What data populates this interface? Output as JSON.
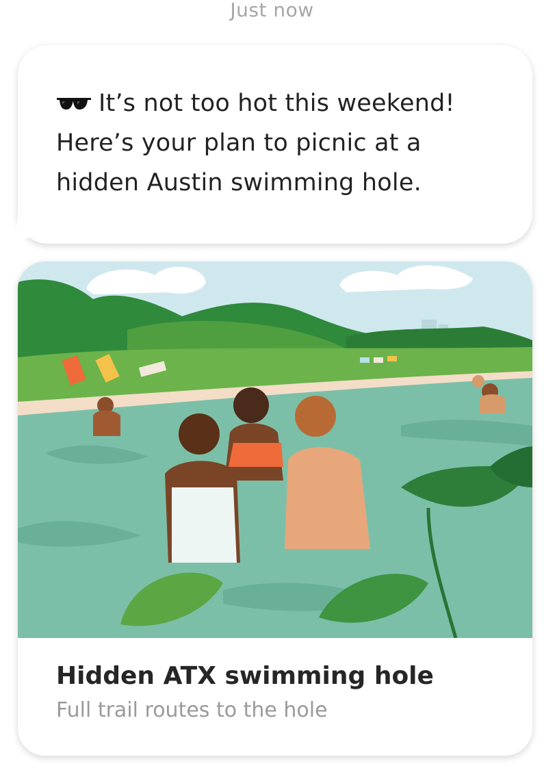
{
  "message": {
    "timestamp": "Just now",
    "emoji_icon": "sunglasses-icon",
    "lines": [
      "It’s not too hot this weekend!",
      "Here’s your plan to picnic at a",
      "hidden Austin swimming hole."
    ]
  },
  "card": {
    "image_icon": "swimming-hole-illustration",
    "title": "Hidden ATX swimming hole",
    "subtitle": "Full trail routes to the hole"
  },
  "colors": {
    "sky": "#cfe8ee",
    "hills": "#2f8a3c",
    "grass": "#6bb34a",
    "water": "#7cbfa8",
    "title_text": "#262626",
    "subtitle_text": "#9a9a9a"
  }
}
